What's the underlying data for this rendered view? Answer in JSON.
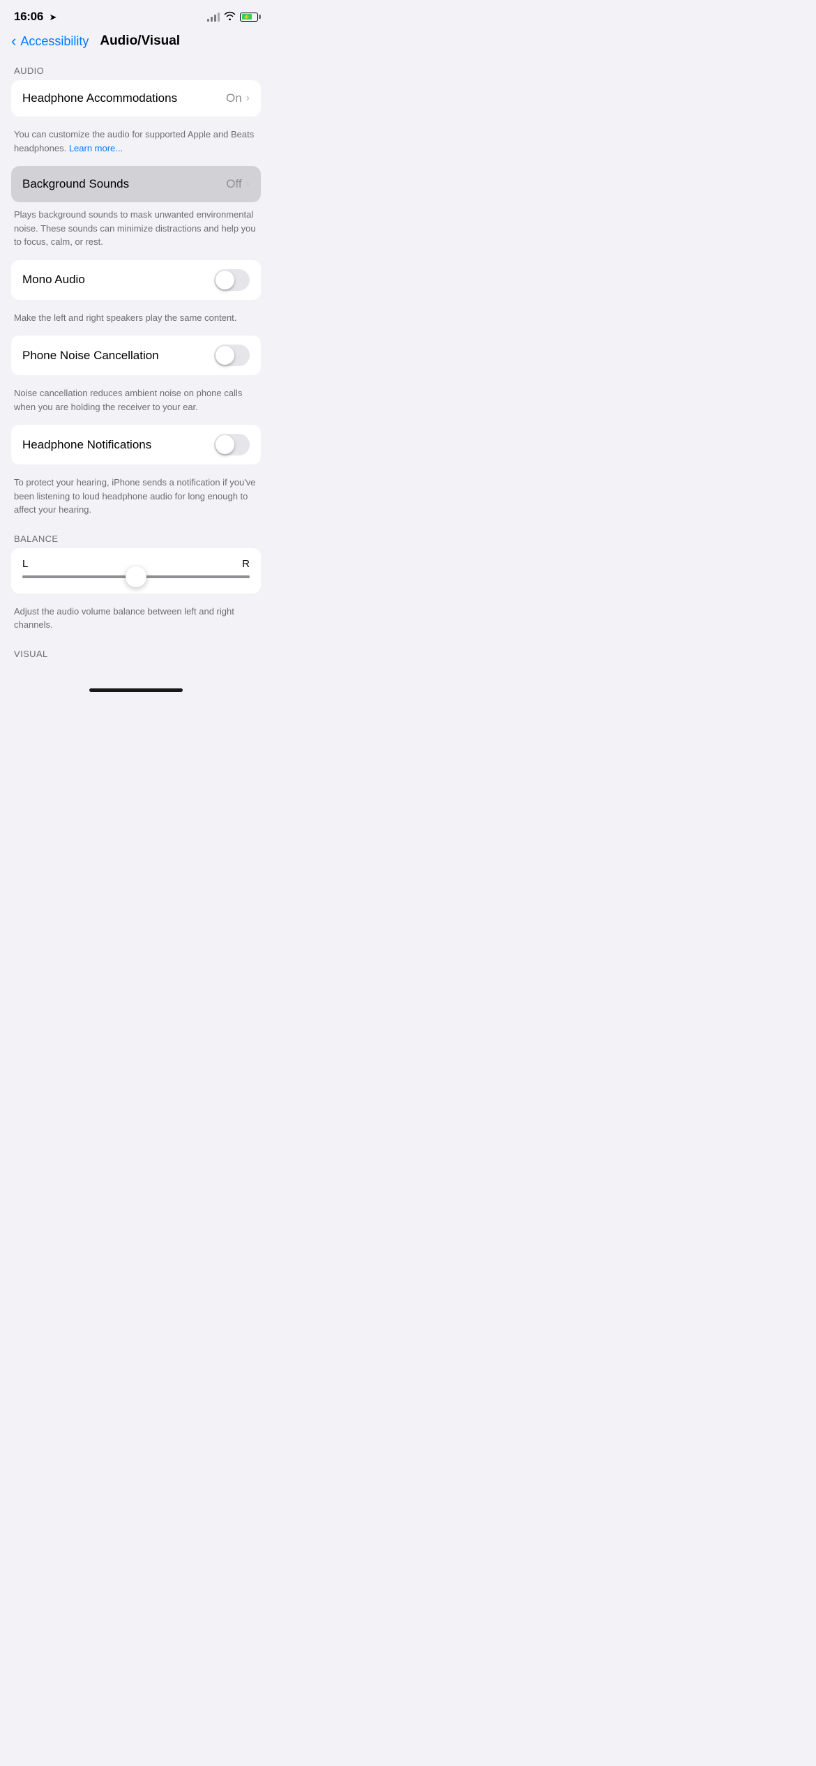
{
  "statusBar": {
    "time": "16:06",
    "locationIcon": "➤",
    "batteryPercent": 70
  },
  "header": {
    "backLabel": "Accessibility",
    "title": "Audio/Visual"
  },
  "sections": {
    "audio": {
      "label": "AUDIO"
    },
    "balance": {
      "label": "BALANCE"
    },
    "visual": {
      "label": "VISUAL"
    }
  },
  "rows": {
    "headphoneAccommodations": {
      "label": "Headphone Accommodations",
      "value": "On"
    },
    "headphoneAccommodationsDesc": "You can customize the audio for supported Apple and Beats headphones.",
    "learnMore": "Learn more...",
    "backgroundSounds": {
      "label": "Background Sounds",
      "value": "Off"
    },
    "backgroundSoundsDesc": "Plays background sounds to mask unwanted environmental noise. These sounds can minimize distractions and help you to focus, calm, or rest.",
    "monoAudio": {
      "label": "Mono Audio",
      "enabled": false
    },
    "monoAudioDesc": "Make the left and right speakers play the same content.",
    "phoneNoiseCancellation": {
      "label": "Phone Noise Cancellation",
      "enabled": false
    },
    "phoneNoiseCancellationDesc": "Noise cancellation reduces ambient noise on phone calls when you are holding the receiver to your ear.",
    "headphoneNotifications": {
      "label": "Headphone Notifications",
      "enabled": false
    },
    "headphoneNotificationsDesc": "To protect your hearing, iPhone sends a notification if you've been listening to loud headphone audio for long enough to affect your hearing.",
    "balance": {
      "leftLabel": "L",
      "rightLabel": "R",
      "value": 0.5
    },
    "balanceDesc": "Adjust the audio volume balance between left and right channels."
  }
}
